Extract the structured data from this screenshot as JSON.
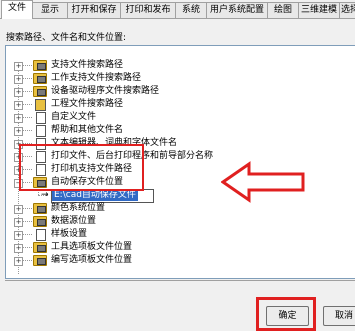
{
  "tabs": [
    "文件",
    "显示",
    "打开和保存",
    "打印和发布",
    "系统",
    "用户系统配置",
    "绘图",
    "三维建模",
    "选择"
  ],
  "caption": "搜索路径、文件名和文件位置:",
  "tree_items": [
    {
      "label": "支持文件搜索路径",
      "icon": "folder-search-icon"
    },
    {
      "label": "工作支持文件搜索路径",
      "icon": "folder-search-icon"
    },
    {
      "label": "设备驱动程序文件搜索路径",
      "icon": "folder-search-icon"
    },
    {
      "label": "工程文件搜索路径",
      "icon": "project-icon"
    },
    {
      "label": "自定义文件",
      "icon": "file-icon"
    },
    {
      "label": "帮助和其他文件名",
      "icon": "file-icon"
    },
    {
      "label": "文本编辑器、词典和字体文件名",
      "icon": "file-icon"
    },
    {
      "label": "打印文件、后台打印程序和前导部分名称",
      "icon": "file-icon"
    },
    {
      "label": "打印机支持文件路径",
      "icon": "file-icon"
    },
    {
      "label": "自动保存文件位置",
      "icon": "folder-search-icon"
    },
    {
      "label": "E:\\cad自动保存文件",
      "icon": "arrow-icon"
    },
    {
      "label": "颜色系统位置",
      "icon": "folder-search-icon"
    },
    {
      "label": "数据源位置",
      "icon": "folder-search-icon"
    },
    {
      "label": "样板设置",
      "icon": "file-icon"
    },
    {
      "label": "工具选项板文件位置",
      "icon": "folder-search-icon"
    },
    {
      "label": "编写选项板文件位置",
      "icon": "folder-search-icon"
    }
  ],
  "buttons": {
    "ok": "确定",
    "cancel": "取消"
  },
  "colors": {
    "selection": "#316ac5",
    "highlight": "#e02020",
    "folder": "#e8c040"
  }
}
